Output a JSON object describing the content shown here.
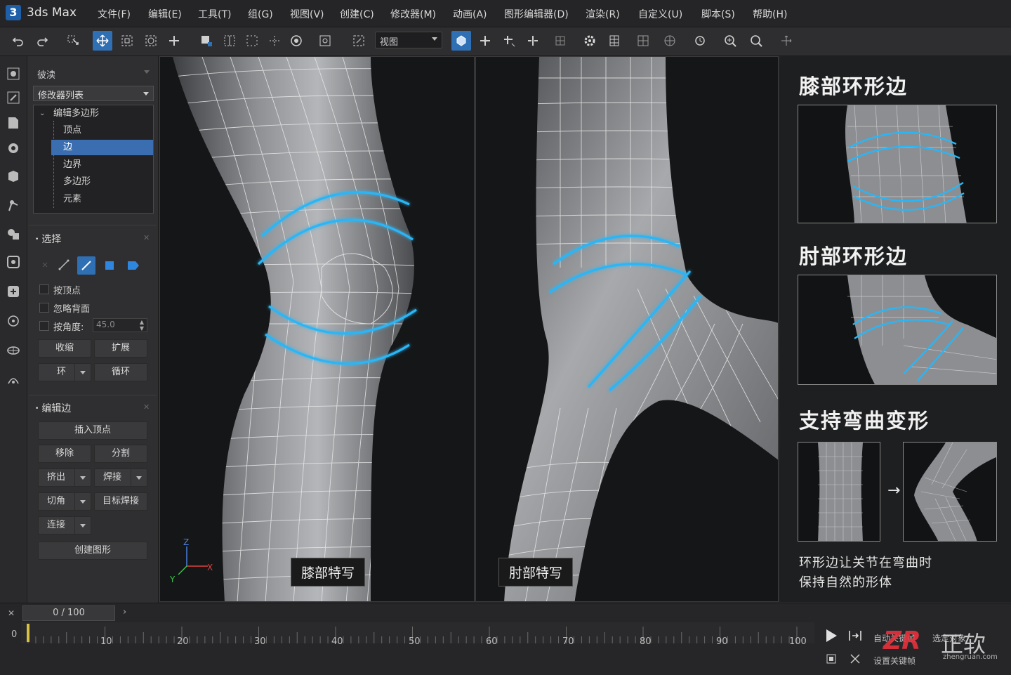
{
  "app": {
    "logo": "3",
    "name": "3ds Max"
  },
  "menu": [
    "文件(F)",
    "编辑(E)",
    "工具(T)",
    "组(G)",
    "视图(V)",
    "创建(C)",
    "修改器(M)",
    "动画(A)",
    "图形编辑器(D)",
    "渲染(R)",
    "自定义(U)",
    "脚本(S)",
    "帮助(H)"
  ],
  "toolbar": {
    "view_dropdown": "视图",
    "accent": "#2f6fb4"
  },
  "command_panel": {
    "object_name": "彼渎",
    "modifier_list": "修改器列表",
    "stack": {
      "modifier": "编辑多边形",
      "subobjects": [
        "顶点",
        "边",
        "边界",
        "多边形",
        "元素"
      ],
      "selected_index": 1
    },
    "selection": {
      "title": "选择",
      "by_vertex": "按顶点",
      "ignore_backfacing": "忽略背面",
      "by_angle": "按角度:",
      "angle_value": "45.0",
      "shrink": "收缩",
      "grow": "扩展",
      "ring": "环",
      "loop": "循环"
    },
    "edit_edges": {
      "title": "编辑边",
      "insert_vertex": "插入顶点",
      "remove": "移除",
      "split": "分割",
      "extrude": "挤出",
      "weld": "焊接",
      "chamfer": "切角",
      "target_weld": "目标焊接",
      "bridge": "连接",
      "create_shape": "创建图形"
    }
  },
  "viewports": {
    "left_label": "膝部特写",
    "right_label": "肘部特写",
    "axis": {
      "z": "Z",
      "x": "X",
      "y": "Y"
    },
    "highlight_color": "#29b6f6"
  },
  "info_panel": {
    "knee_title": "膝部环形边",
    "elbow_title": "肘部环形边",
    "deform_title": "支持弯曲变形",
    "arrow": "→",
    "caption_line1": "环形边让关节在弯曲时",
    "caption_line2": "保持自然的形体"
  },
  "timeline": {
    "frame_display": "0 / 100",
    "start": "0",
    "ticks": [
      "10",
      "20",
      "30",
      "40",
      "50",
      "60",
      "70",
      "80",
      "90",
      "100"
    ],
    "auto_key": "自动关键帧",
    "selected": "选定对象",
    "set_key": "设置关键帧"
  },
  "watermark": {
    "logo": "ZR",
    "text": "正软",
    "url": "zhengruan.com"
  }
}
